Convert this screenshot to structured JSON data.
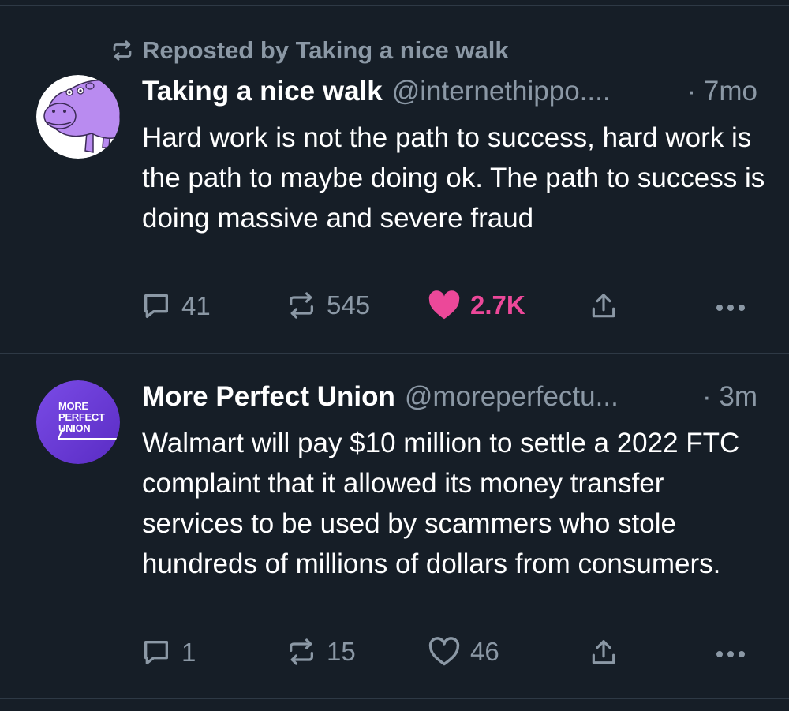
{
  "colors": {
    "background": "#161e27",
    "divider": "#2e3945",
    "muted": "#8b98a5",
    "like_active": "#ec4899",
    "hippo_avatar": "#b98bf0",
    "union_avatar": "#6a39d8"
  },
  "posts": [
    {
      "repost_label": "Reposted by Taking a nice walk",
      "author_name": "Taking a nice walk",
      "author_handle": "@internethippo....",
      "time": "· 7mo",
      "text": "Hard work is not the path to success, hard work is the path to maybe doing ok. The path to success is doing massive and severe fraud",
      "replies": "41",
      "reposts": "545",
      "likes": "2.7K",
      "liked": true,
      "avatar_icon": "hippo-avatar"
    },
    {
      "author_name": "More Perfect Union",
      "author_handle": "@moreperfectu...",
      "time": "· 3m",
      "text": "Walmart will pay $10 million to settle a 2022 FTC complaint that it allowed its money transfer services to be used by scammers who stole hundreds of millions of dollars from consumers.",
      "replies": "1",
      "reposts": "15",
      "likes": "46",
      "liked": false,
      "avatar_icon": "more-perfect-union-logo",
      "avatar_text": [
        "MORE",
        "PERFECT",
        "UNION"
      ]
    }
  ]
}
